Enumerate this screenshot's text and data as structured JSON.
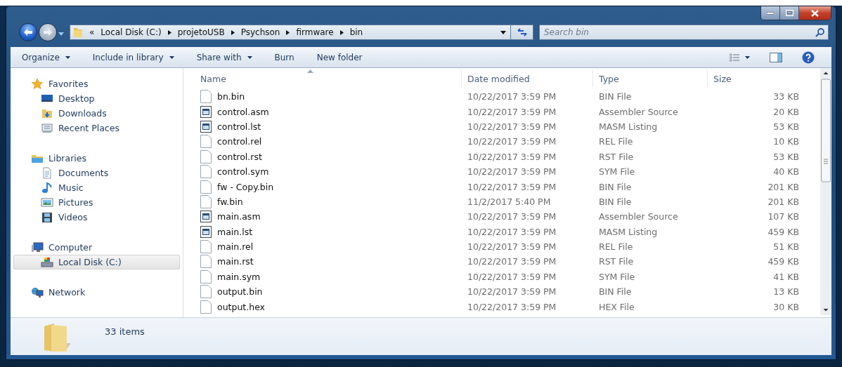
{
  "address": {
    "overflow": "«",
    "path": [
      "Local Disk (C:)",
      "projetoUSB",
      "Psychson",
      "firmware",
      "bin"
    ]
  },
  "search": {
    "placeholder": "Search bin"
  },
  "toolbar": [
    {
      "label": "Organize",
      "menu": true
    },
    {
      "label": "Include in library",
      "menu": true
    },
    {
      "label": "Share with",
      "menu": true
    },
    {
      "label": "Burn",
      "menu": false
    },
    {
      "label": "New folder",
      "menu": false
    }
  ],
  "sidebar": [
    {
      "label": "Favorites",
      "children": [
        {
          "label": "Desktop",
          "selected": false
        },
        {
          "label": "Downloads",
          "selected": false
        },
        {
          "label": "Recent Places",
          "selected": false
        }
      ]
    },
    {
      "label": "Libraries",
      "children": [
        {
          "label": "Documents",
          "selected": false
        },
        {
          "label": "Music",
          "selected": false
        },
        {
          "label": "Pictures",
          "selected": false
        },
        {
          "label": "Videos",
          "selected": false
        }
      ]
    },
    {
      "label": "Computer",
      "children": [
        {
          "label": "Local Disk (C:)",
          "selected": true
        }
      ]
    },
    {
      "label": "Network"
    }
  ],
  "table": {
    "columns": [
      {
        "label": "Name",
        "sorted": true
      },
      {
        "label": "Date modified",
        "sorted": false
      },
      {
        "label": "Type",
        "sorted": false
      },
      {
        "label": "Size",
        "sorted": false
      }
    ],
    "rows": [
      {
        "kind": "file",
        "name": "bn.bin",
        "date": "10/22/2017 3:59 PM",
        "type": "BIN File",
        "size": "33 KB"
      },
      {
        "kind": "script",
        "name": "control.asm",
        "date": "10/22/2017 3:59 PM",
        "type": "Assembler Source",
        "size": "20 KB"
      },
      {
        "kind": "script",
        "name": "control.lst",
        "date": "10/22/2017 3:59 PM",
        "type": "MASM Listing",
        "size": "53 KB"
      },
      {
        "kind": "file",
        "name": "control.rel",
        "date": "10/22/2017 3:59 PM",
        "type": "REL File",
        "size": "10 KB"
      },
      {
        "kind": "file",
        "name": "control.rst",
        "date": "10/22/2017 3:59 PM",
        "type": "RST File",
        "size": "53 KB"
      },
      {
        "kind": "file",
        "name": "control.sym",
        "date": "10/22/2017 3:59 PM",
        "type": "SYM File",
        "size": "40 KB"
      },
      {
        "kind": "file",
        "name": "fw - Copy.bin",
        "date": "10/22/2017 3:59 PM",
        "type": "BIN File",
        "size": "201 KB"
      },
      {
        "kind": "file",
        "name": "fw.bin",
        "date": "11/2/2017 5:40 PM",
        "type": "BIN File",
        "size": "201 KB"
      },
      {
        "kind": "script",
        "name": "main.asm",
        "date": "10/22/2017 3:59 PM",
        "type": "Assembler Source",
        "size": "107 KB"
      },
      {
        "kind": "script",
        "name": "main.lst",
        "date": "10/22/2017 3:59 PM",
        "type": "MASM Listing",
        "size": "459 KB"
      },
      {
        "kind": "file",
        "name": "main.rel",
        "date": "10/22/2017 3:59 PM",
        "type": "REL File",
        "size": "51 KB"
      },
      {
        "kind": "file",
        "name": "main.rst",
        "date": "10/22/2017 3:59 PM",
        "type": "RST File",
        "size": "459 KB"
      },
      {
        "kind": "file",
        "name": "main.sym",
        "date": "10/22/2017 3:59 PM",
        "type": "SYM File",
        "size": "41 KB"
      },
      {
        "kind": "file",
        "name": "output.bin",
        "date": "10/22/2017 3:59 PM",
        "type": "BIN File",
        "size": "13 KB"
      },
      {
        "kind": "file",
        "name": "output.hex",
        "date": "10/22/2017 3:59 PM",
        "type": "HEX File",
        "size": "30 KB"
      }
    ]
  },
  "status_bar": {
    "count": "33 items"
  }
}
